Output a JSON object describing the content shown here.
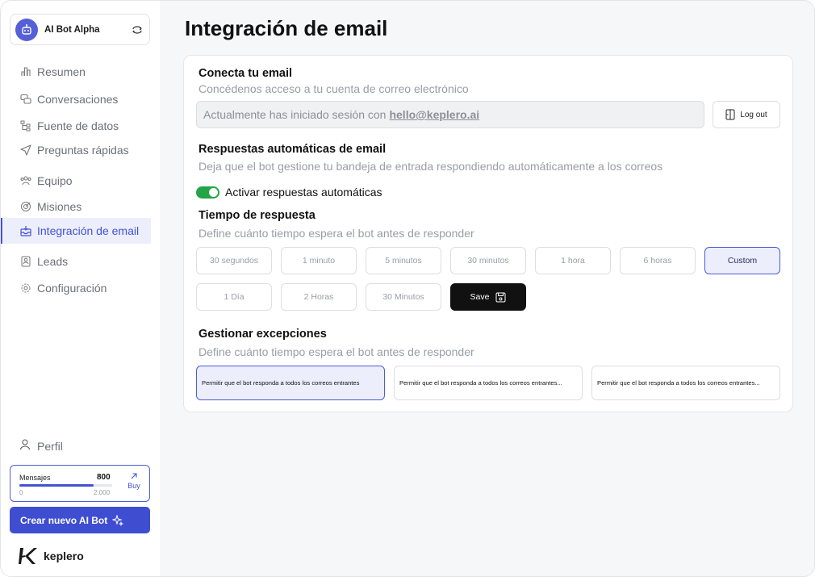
{
  "sidebar": {
    "bot_name": "AI Bot Alpha",
    "items": [
      {
        "label": "Resumen",
        "icon": "chart-icon"
      },
      {
        "label": "Conversaciones",
        "icon": "chat-icon"
      },
      {
        "label": "Fuente de datos",
        "icon": "data-source-icon"
      },
      {
        "label": "Preguntas rápidas",
        "icon": "send-icon"
      },
      {
        "label": "Equipo",
        "icon": "team-icon"
      },
      {
        "label": "Misiones",
        "icon": "target-icon"
      },
      {
        "label": "Integración de email",
        "icon": "inbox-icon",
        "active": true
      },
      {
        "label": "Leads",
        "icon": "leads-icon"
      },
      {
        "label": "Configuración",
        "icon": "gear-icon"
      }
    ],
    "profile_label": "Perfil",
    "credits": {
      "label": "Mensajes",
      "value": "800",
      "min": "0",
      "max": "2.000",
      "fraction": 0.8,
      "buy_label": "Buy"
    },
    "new_bot_label": "Crear nuevo AI Bot",
    "brand_name": "keplero"
  },
  "main": {
    "title": "Integración de email",
    "connect": {
      "title": "Conecta tu email",
      "subtitle": "Concédenos acceso a tu cuenta de correo electrónico",
      "session_text": "Actualmente has iniciado sesión con",
      "email": "hello@keplero.ai",
      "logout_label": "Log out"
    },
    "auto": {
      "title": "Respuestas automáticas de email",
      "subtitle": "Deja que el bot gestione tu bandeja de entrada respondiendo automáticamente a los correos",
      "toggle_label": "Activar respuestas automáticas",
      "toggle_on": true
    },
    "timing": {
      "title": "Tiempo de respuesta",
      "subtitle": "Define cuánto tiempo espera el bot antes de responder",
      "row1": [
        "30 segundos",
        "1 minuto",
        "5 minutos",
        "30 minutos",
        "1 hora",
        "6 horas",
        "Custom"
      ],
      "row2": [
        "1 Día",
        "2 Horas",
        "30 Minutos"
      ],
      "selected": "Custom",
      "save_label": "Save"
    },
    "exceptions": {
      "title": "Gestionar excepciones",
      "subtitle": "Define cuánto tiempo espera el bot antes de responder",
      "options": [
        "Permitir que el bot responda a todos los correos entrantes",
        "Permitir que el bot responda a todos los correos entrantes...",
        "Permitir que el bot responda a todos los correos entrantes..."
      ]
    }
  },
  "colors": {
    "accent": "#4352d3",
    "toggle": "#22a447",
    "save": "#111111"
  }
}
